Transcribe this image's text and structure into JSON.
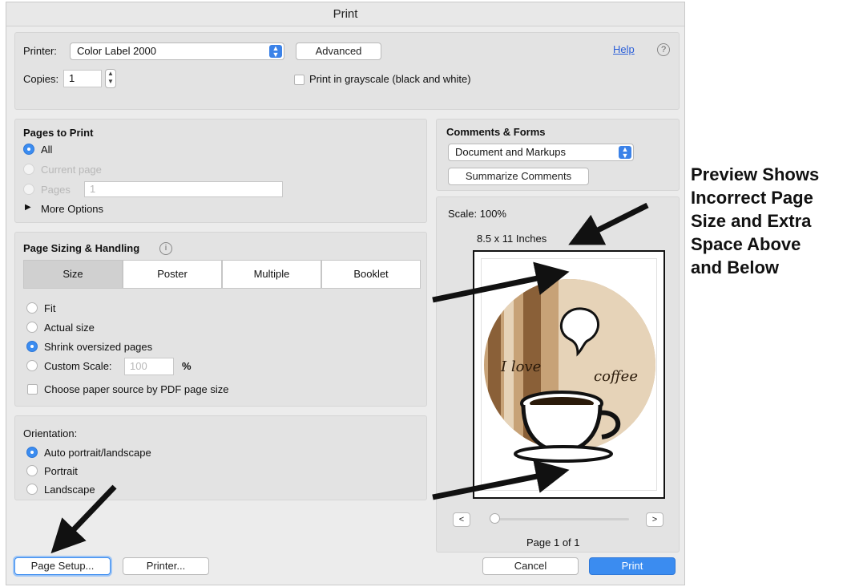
{
  "window": {
    "title": "Print"
  },
  "printer": {
    "label": "Printer:",
    "value": "Color Label 2000",
    "advanced_label": "Advanced",
    "help_label": "Help",
    "copies_label": "Copies:",
    "copies_value": "1",
    "grayscale_label": "Print in grayscale (black and white)"
  },
  "pages_to_print": {
    "title": "Pages to Print",
    "all_label": "All",
    "current_label": "Current page",
    "pages_label": "Pages",
    "pages_value": "1",
    "more_options_label": "More Options"
  },
  "page_sizing": {
    "title": "Page Sizing & Handling",
    "tabs": [
      "Size",
      "Poster",
      "Multiple",
      "Booklet"
    ],
    "fit_label": "Fit",
    "actual_size_label": "Actual size",
    "shrink_label": "Shrink oversized pages",
    "custom_scale_label": "Custom Scale:",
    "custom_scale_value": "100",
    "percent_label": "%",
    "paper_source_label": "Choose paper source by PDF page size"
  },
  "orientation": {
    "title": "Orientation:",
    "auto_label": "Auto portrait/landscape",
    "portrait_label": "Portrait",
    "landscape_label": "Landscape"
  },
  "comments_forms": {
    "title": "Comments & Forms",
    "value": "Document and Markups",
    "summarize_label": "Summarize Comments"
  },
  "preview": {
    "scale_label": "Scale: 100%",
    "page_size_label": "8.5 x 11 Inches",
    "prev_label": "<",
    "next_label": ">",
    "page_label": "Page 1 of 1",
    "label_text_left": "I love",
    "label_text_right": "coffee",
    "label_url": "www.primeralabel.com/coffee_labels.html"
  },
  "footer": {
    "page_setup_label": "Page Setup...",
    "printer_label": "Printer...",
    "cancel_label": "Cancel",
    "print_label": "Print"
  },
  "annotation": {
    "lines": [
      "Preview Shows",
      "Incorrect Page",
      "Size and Extra",
      "Space Above",
      "and Below"
    ]
  },
  "colors": {
    "accent": "#3b8cf0",
    "label_tan": "#c7a277",
    "label_dark": "#8a6038",
    "label_light": "#e6d3b8"
  }
}
